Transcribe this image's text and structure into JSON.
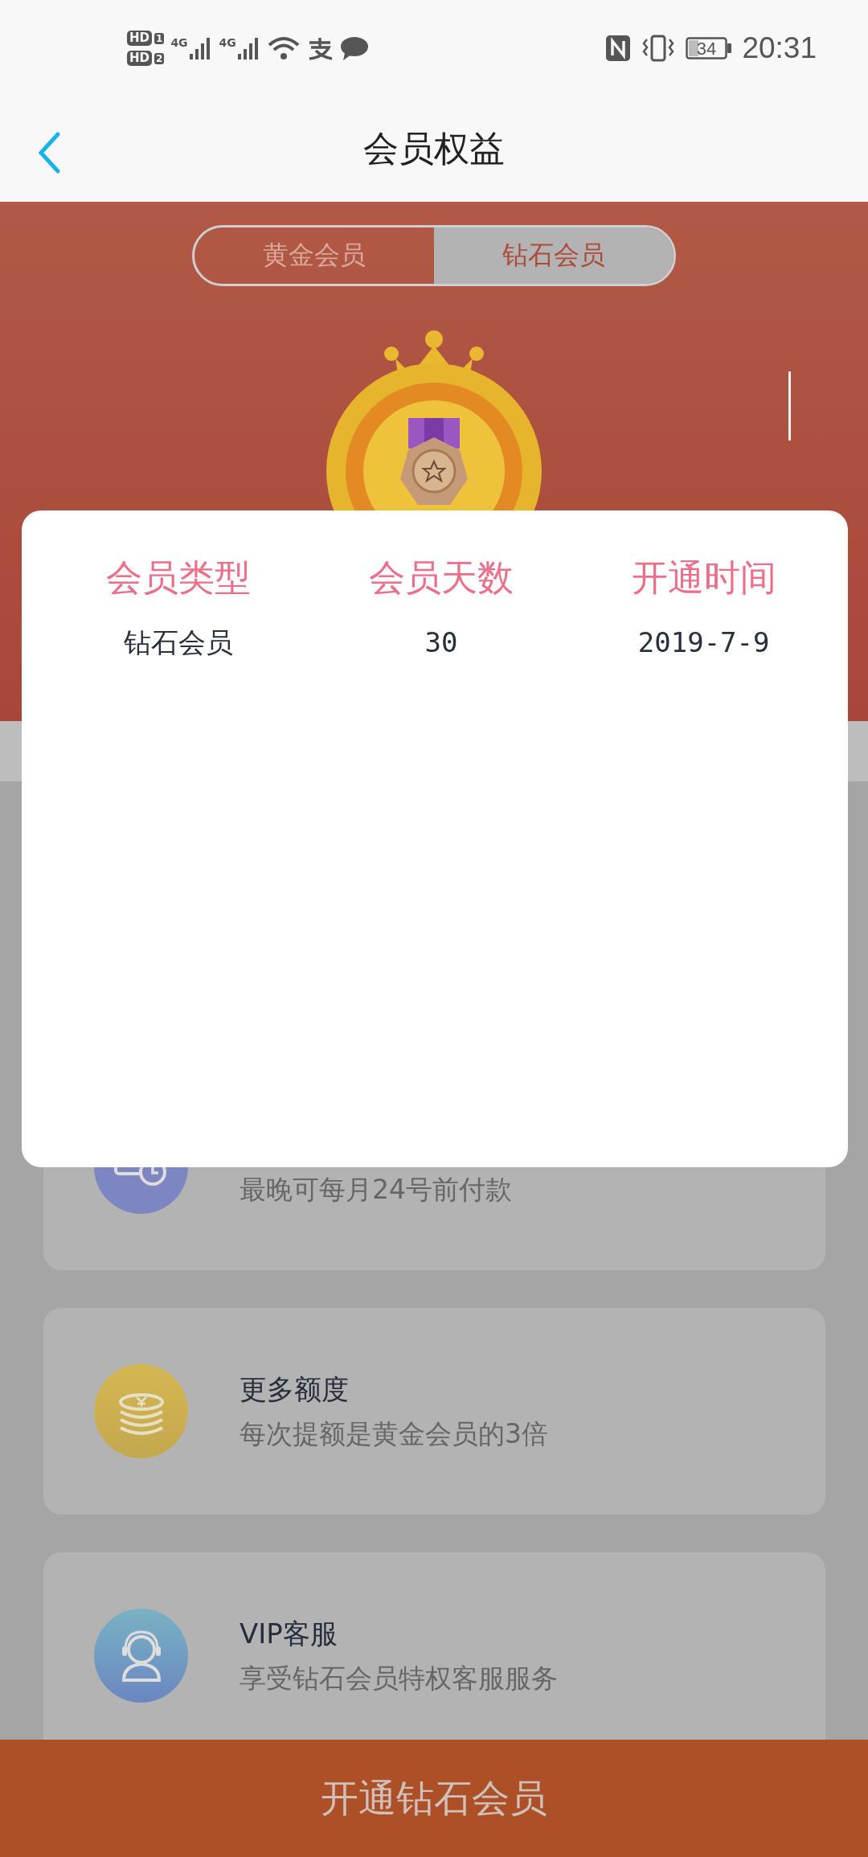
{
  "status_bar": {
    "sims": [
      {
        "badge": "HD",
        "slot": "1"
      },
      {
        "badge": "HD",
        "slot": "2"
      }
    ],
    "networks": [
      "4G",
      "4G"
    ],
    "battery": "34",
    "time": "20:31"
  },
  "header": {
    "title": "会员权益"
  },
  "tabs": [
    {
      "label": "黄金会员",
      "selected": false
    },
    {
      "label": "钻石会员",
      "selected": true
    }
  ],
  "benefits": [
    {
      "kind": "calendar",
      "subtitle": "最晚可每月24号前付款"
    },
    {
      "kind": "coins",
      "title": "更多额度",
      "subtitle": "每次提额是黄金会员的3倍"
    },
    {
      "kind": "support",
      "title": "VIP客服",
      "subtitle": "享受钻石会员特权客服服务"
    }
  ],
  "dialog": {
    "columns": [
      "会员类型",
      "会员天数",
      "开通时间"
    ],
    "rows": [
      [
        "钻石会员",
        "30",
        "2019-7-9"
      ]
    ]
  },
  "action_button": {
    "label": "开通钻石会员"
  }
}
